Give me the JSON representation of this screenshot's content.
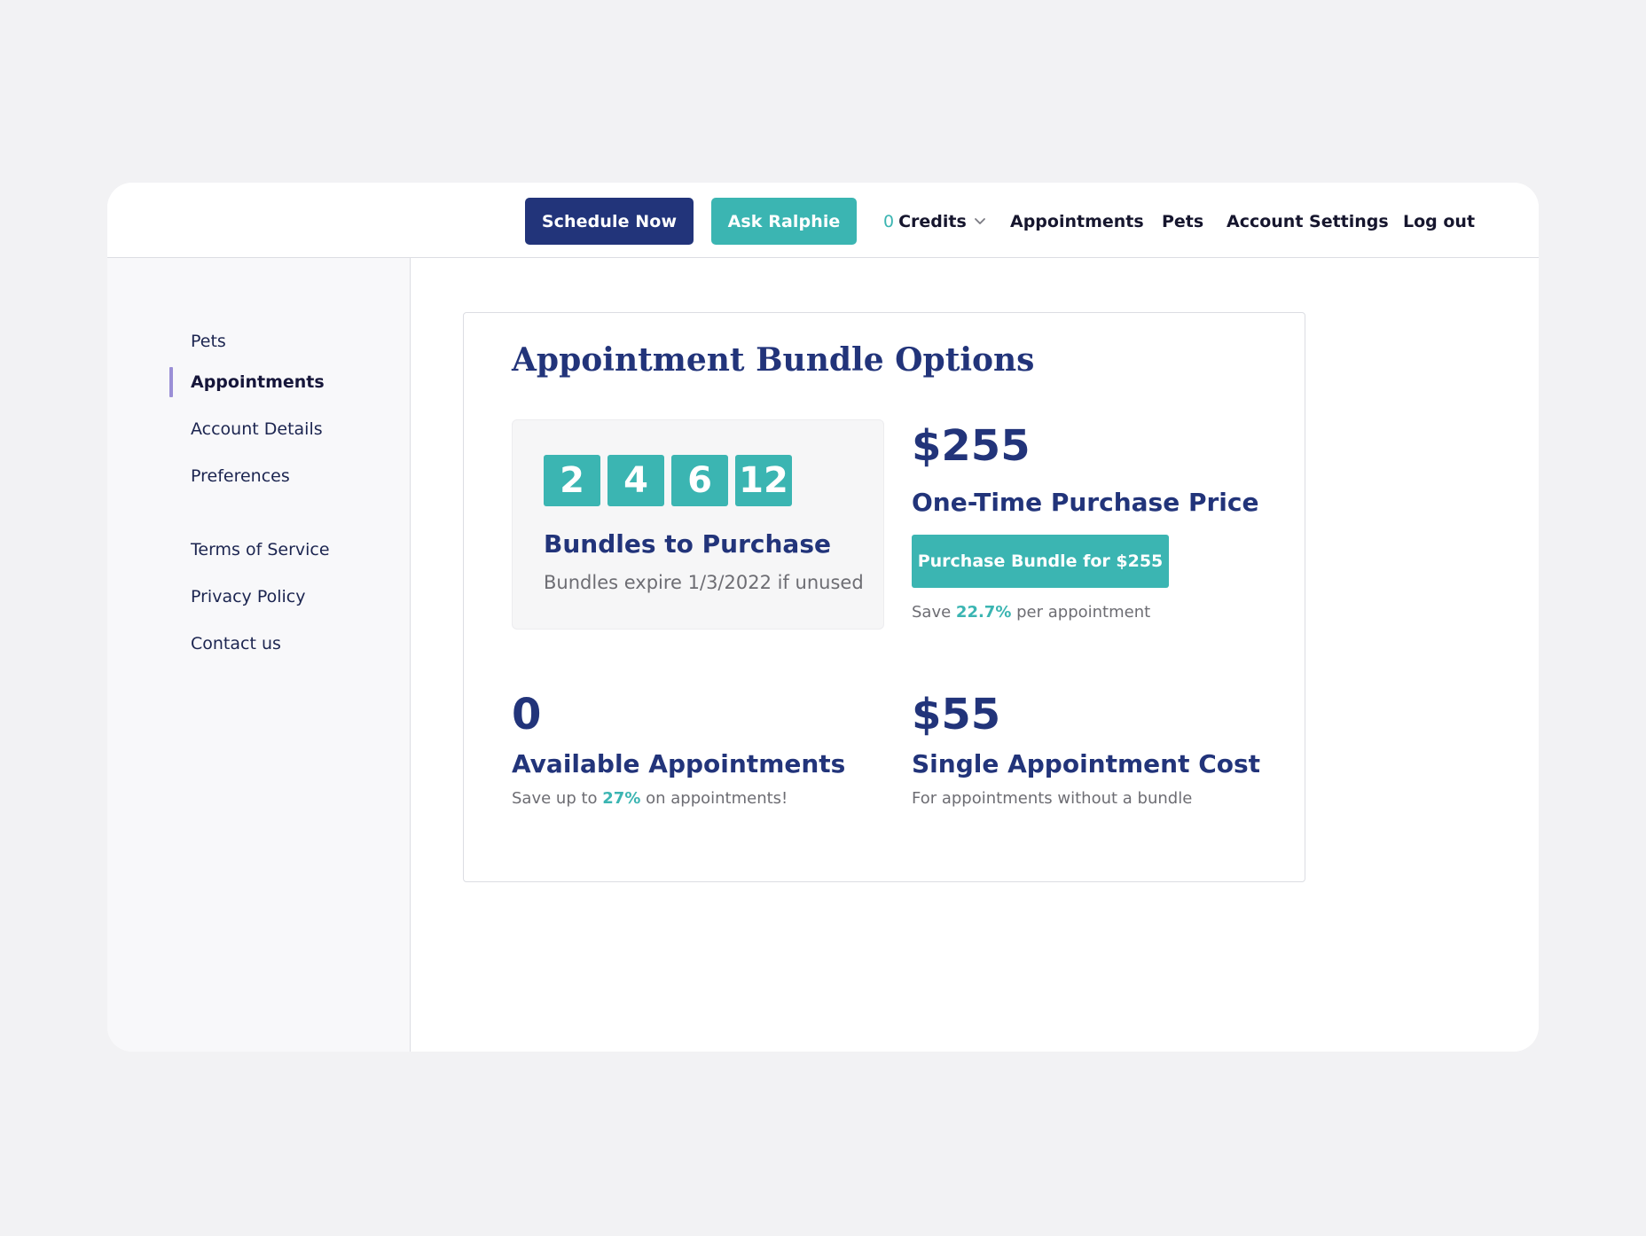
{
  "header": {
    "schedule_label": "Schedule Now",
    "ask_label": "Ask Ralphie",
    "credits_count": "0",
    "credits_label": "Credits",
    "nav": [
      "Appointments",
      "Pets",
      "Account Settings",
      "Log out"
    ]
  },
  "sidebar": {
    "items": [
      "Pets",
      "Appointments",
      "Account Details",
      "Preferences"
    ],
    "footer_items": [
      "Terms of Service",
      "Privacy Policy",
      "Contact us"
    ],
    "active_item": "Appointments"
  },
  "bundle_card": {
    "title": "Appointment Bundle Options",
    "bundle_sizes": [
      "2",
      "4",
      "6",
      "12"
    ],
    "bundles_label": "Bundles to Purchase",
    "bundles_sub": "Bundles expire 1/3/2022 if unused",
    "price": "$255",
    "price_label": "One-Time Purchase Price",
    "purchase_button": "Purchase Bundle for $255",
    "save_prefix": "Save",
    "save_pct": "22.7%",
    "save_suffix": "per appointment",
    "available_count": "0",
    "available_label": "Available Appointments",
    "available_sub_prefix": "Save up to",
    "available_sub_pct": "27%",
    "available_sub_suffix": "on appointments!",
    "single_cost": "$55",
    "single_label": "Single Appointment Cost",
    "single_sub": "For appointments without a bundle"
  },
  "colors": {
    "navy": "#22347a",
    "teal": "#3bb5b2",
    "active_indicator": "#9b8fd6"
  },
  "icons": {
    "credits_dropdown": "chevron-down-icon"
  }
}
